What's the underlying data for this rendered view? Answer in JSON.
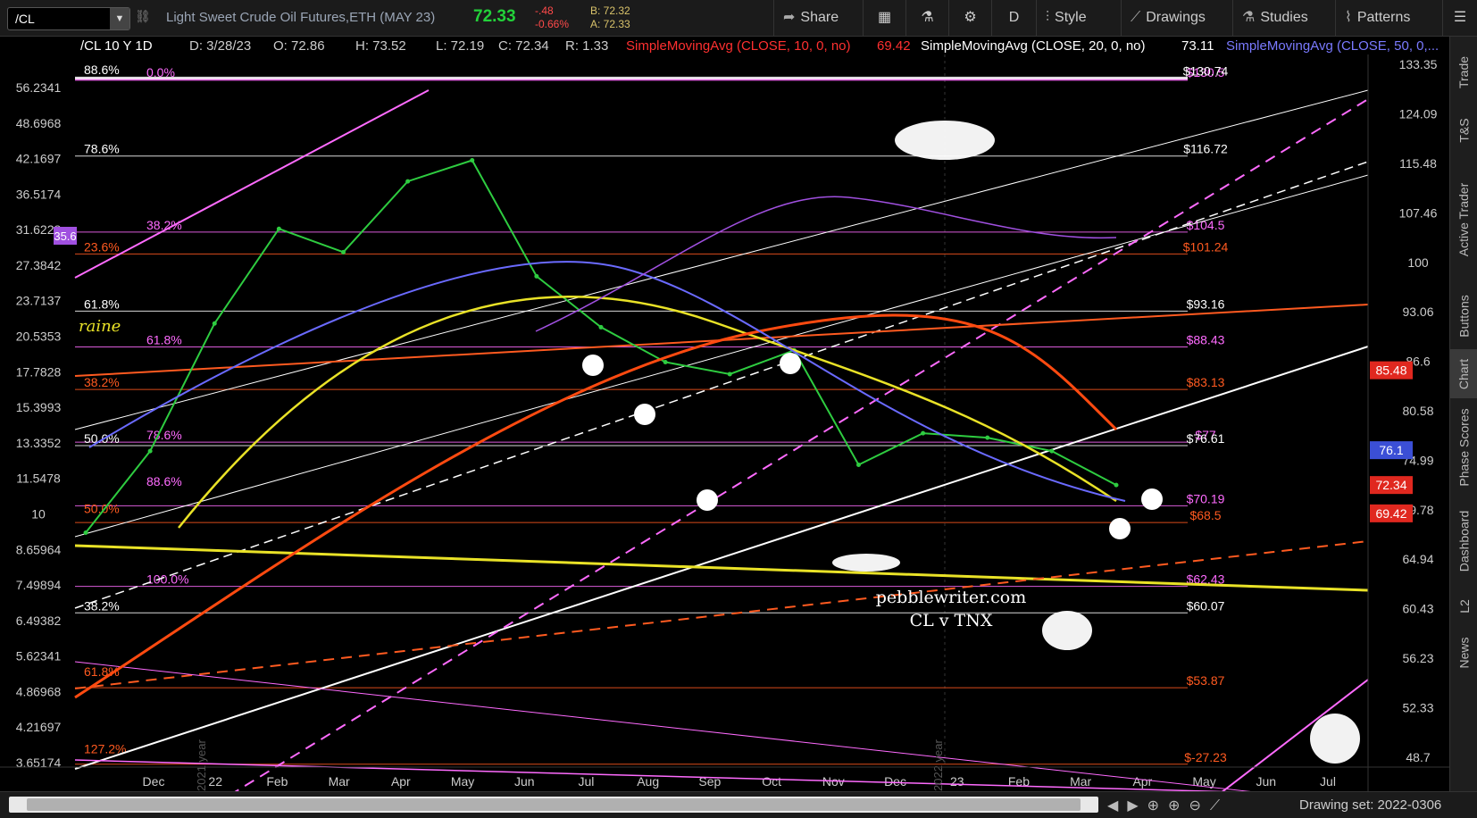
{
  "toolbar": {
    "symbol": "/CL",
    "description": "Light Sweet Crude Oil Futures,ETH (MAY 23)",
    "last": "72.33",
    "change": "-.48",
    "change_pct": "-0.66%",
    "bid": "B: 72.32",
    "ask": "A: 72.33",
    "share": "Share",
    "period": "D",
    "style": "Style",
    "drawings": "Drawings",
    "studies": "Studies",
    "patterns": "Patterns"
  },
  "header": {
    "title": "/CL 10 Y 1D",
    "date": "D: 3/28/23",
    "open": "O: 72.86",
    "high": "H: 73.52",
    "low": "L: 72.19",
    "close": "C: 72.34",
    "range": "R: 1.33",
    "sma10": "SimpleMovingAvg (CLOSE, 10, 0, no)",
    "sma10_val": "69.42",
    "sma20": "SimpleMovingAvg (CLOSE, 20, 0, no)",
    "sma20_val": "73.11",
    "sma50": "SimpleMovingAvg (CLOSE, 50, 0,..."
  },
  "colors": {
    "background": "#000000",
    "price": "#2ecc40",
    "sma10": "#ff2a2a",
    "sma20": "#ffffff",
    "sma50": "#6a6aff",
    "sma200_orange": "#ff4a10",
    "yellow_ma": "#e9e227",
    "tnx": "#a050e0",
    "fib_magenta": "#ff6bff",
    "fib_orange": "#ff5a20"
  },
  "chart_data": {
    "type": "line",
    "x_tick_labels": [
      "Dec",
      "22",
      "Feb",
      "Mar",
      "Apr",
      "May",
      "Jun",
      "Jul",
      "Aug",
      "Sep",
      "Oct",
      "Nov",
      "Dec",
      "23",
      "Feb",
      "Mar",
      "Apr",
      "May",
      "Jun",
      "Jul"
    ],
    "right_axis_ticks": [
      133.35,
      124.09,
      115.48,
      107.46,
      100,
      93.06,
      86.6,
      80.58,
      74.99,
      69.78,
      64.94,
      60.43,
      56.23,
      52.33,
      48.7
    ],
    "right_axis_tick_labels": [
      "133.35",
      "124.09",
      "115.48",
      "107.46",
      "100",
      "93.06",
      "86.6",
      "80.58",
      "74.99",
      "69.78",
      "64.94",
      "60.43",
      "56.23",
      "52.33",
      "48.7"
    ],
    "left_axis_tick_labels": [
      "56.2341",
      "48.6968",
      "42.1697",
      "36.5174",
      "31.6228",
      "27.3842",
      "23.7137",
      "20.5353",
      "17.7828",
      "15.3993",
      "13.3352",
      "11.5478",
      "10",
      "8.65964",
      "7.49894",
      "6.49382",
      "5.62341",
      "4.86968",
      "4.21697",
      "3.65174"
    ],
    "price_badges": [
      {
        "label": "85.48",
        "value": 85.48,
        "color": "#e0281f"
      },
      {
        "label": "76.1",
        "value": 76.1,
        "color": "#3b4fd6"
      },
      {
        "label": "72.34",
        "value": 72.34,
        "color": "#e0281f"
      },
      {
        "label": "69.42",
        "value": 69.42,
        "color": "#e0281f"
      }
    ],
    "left_badge": {
      "label": "35.6",
      "value": 35.6,
      "color": "#a050e0"
    },
    "price_levels": [
      {
        "label": "$130.5",
        "value": 130.5,
        "color": "#ff6bff"
      },
      {
        "label": "$130.74",
        "value": 130.74,
        "color": "#ffffff"
      },
      {
        "label": "$116.72",
        "value": 116.72,
        "color": "#ffffff"
      },
      {
        "label": "$104.5",
        "value": 104.5,
        "color": "#ff6bff"
      },
      {
        "label": "$101.24",
        "value": 101.24,
        "color": "#ff5a20"
      },
      {
        "label": "$93.16",
        "value": 93.16,
        "color": "#ffffff"
      },
      {
        "label": "$88.43",
        "value": 88.43,
        "color": "#ff6bff"
      },
      {
        "label": "$83.13",
        "value": 83.13,
        "color": "#ff5a20"
      },
      {
        "label": "$77",
        "value": 77,
        "color": "#ff6bff"
      },
      {
        "label": "$76.61",
        "value": 76.61,
        "color": "#ffffff"
      },
      {
        "label": "$70.19",
        "value": 70.19,
        "color": "#ff6bff"
      },
      {
        "label": "$68.5",
        "value": 68.5,
        "color": "#ff5a20"
      },
      {
        "label": "$62.43",
        "value": 62.43,
        "color": "#ff6bff"
      },
      {
        "label": "$60.07",
        "value": 60.07,
        "color": "#ffffff"
      },
      {
        "label": "$53.87",
        "value": 53.87,
        "color": "#ff5a20"
      },
      {
        "label": "$-27.23",
        "value": 48.2,
        "color": "#ff5a20"
      }
    ],
    "fib_labels": [
      {
        "label": "88.6%",
        "value": 131,
        "color": "#ffffff",
        "pos": "left"
      },
      {
        "label": "0.0%",
        "value": 130.5,
        "color": "#ff6bff",
        "pos": "inner"
      },
      {
        "label": "78.6%",
        "value": 116.72,
        "color": "#ffffff",
        "pos": "left"
      },
      {
        "label": "38.2%",
        "value": 104.5,
        "color": "#ff6bff",
        "pos": "inner"
      },
      {
        "label": "23.6%",
        "value": 101.24,
        "color": "#ff5a20",
        "pos": "left"
      },
      {
        "label": "61.8%",
        "value": 93.16,
        "color": "#ffffff",
        "pos": "left"
      },
      {
        "label": "61.8%",
        "value": 88.43,
        "color": "#ff6bff",
        "pos": "inner"
      },
      {
        "label": "38.2%",
        "value": 83.13,
        "color": "#ff5a20",
        "pos": "left"
      },
      {
        "label": "50.0%",
        "value": 76.61,
        "color": "#ffffff",
        "pos": "left"
      },
      {
        "label": "78.6%",
        "value": 77,
        "color": "#ff6bff",
        "pos": "inner"
      },
      {
        "label": "88.6%",
        "value": 72.0,
        "color": "#ff6bff",
        "pos": "inner"
      },
      {
        "label": "50.0%",
        "value": 69.2,
        "color": "#ff5a20",
        "pos": "left"
      },
      {
        "label": "100.0%",
        "value": 62.43,
        "color": "#ff6bff",
        "pos": "inner"
      },
      {
        "label": "38.2%",
        "value": 60.07,
        "color": "#ffffff",
        "pos": "left"
      },
      {
        "label": "61.8%",
        "value": 54.6,
        "color": "#ff5a20",
        "pos": "left"
      },
      {
        "label": "127.2%",
        "value": 48.8,
        "color": "#ff5a20",
        "pos": "left"
      }
    ],
    "annotations": {
      "watermark": "pebblewriter.com",
      "subtitle": "CL v TNX",
      "year_2021": "2021 year",
      "year_2022": "2022 year",
      "partial_label": "raine"
    },
    "ylim": [
      48.0,
      138.5
    ],
    "yscale": "log",
    "price_close_series": [
      {
        "t": "Dec",
        "v": 67.5
      },
      {
        "t": "22",
        "v": 76.0
      },
      {
        "t": "Feb",
        "v": 91.5
      },
      {
        "t": "Mar",
        "v": 105.0
      },
      {
        "t": "Apr",
        "v": 101.5
      },
      {
        "t": "May",
        "v": 112.5
      },
      {
        "t": "Jun",
        "v": 116.0
      },
      {
        "t": "Jul",
        "v": 98.0
      },
      {
        "t": "Aug",
        "v": 91.0
      },
      {
        "t": "Sep",
        "v": 86.5
      },
      {
        "t": "Oct",
        "v": 85.0
      },
      {
        "t": "Nov",
        "v": 88.0
      },
      {
        "t": "Dec",
        "v": 74.5
      },
      {
        "t": "23",
        "v": 78.0
      },
      {
        "t": "Feb",
        "v": 77.5
      },
      {
        "t": "Mar",
        "v": 76.0
      },
      {
        "t": "Mar-late",
        "v": 72.34
      }
    ]
  },
  "right_rail": [
    "Trade",
    "T&S",
    "Active Trader",
    "Buttons",
    "Chart",
    "Phase Scores",
    "Dashboard",
    "L2",
    "News"
  ],
  "bottom": {
    "drawing_set": "Drawing set: 2022-0306"
  }
}
